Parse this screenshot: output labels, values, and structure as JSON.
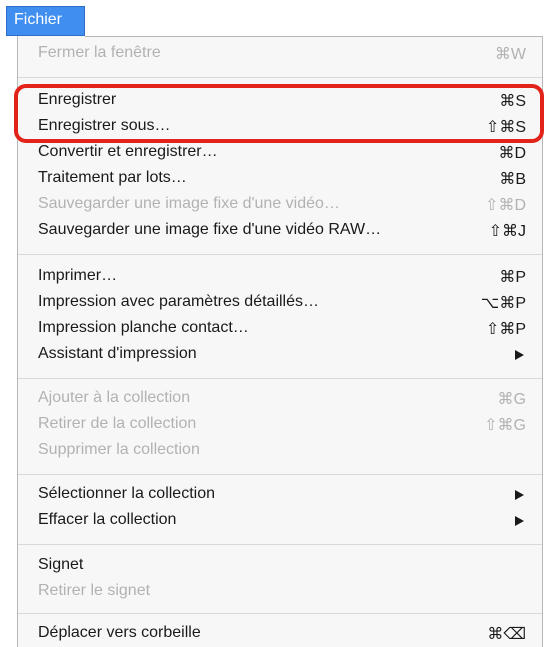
{
  "menubar": {
    "title": "Fichier"
  },
  "menu": {
    "items": [
      {
        "label": "Fermer la fenêtre",
        "shortcut": "⌘W",
        "enabled": false
      },
      {
        "label": "Enregistrer",
        "shortcut": "⌘S",
        "enabled": true
      },
      {
        "label": "Enregistrer sous…",
        "shortcut": "⇧⌘S",
        "enabled": true
      },
      {
        "label": "Convertir et enregistrer…",
        "shortcut": "⌘D",
        "enabled": true
      },
      {
        "label": "Traitement par lots…",
        "shortcut": "⌘B",
        "enabled": true
      },
      {
        "label": "Sauvegarder une image fixe d'une vidéo…",
        "shortcut": "⇧⌘D",
        "enabled": false
      },
      {
        "label": "Sauvegarder une image fixe d'une vidéo RAW…",
        "shortcut": "⇧⌘J",
        "enabled": true
      },
      {
        "label": "Imprimer…",
        "shortcut": "⌘P",
        "enabled": true
      },
      {
        "label": "Impression avec paramètres détaillés…",
        "shortcut": "⌥⌘P",
        "enabled": true
      },
      {
        "label": "Impression planche contact…",
        "shortcut": "⇧⌘P",
        "enabled": true
      },
      {
        "label": "Assistant d'impression",
        "shortcut": "",
        "enabled": true,
        "submenu": true
      },
      {
        "label": "Ajouter à la collection",
        "shortcut": "⌘G",
        "enabled": false
      },
      {
        "label": "Retirer de la collection",
        "shortcut": "⇧⌘G",
        "enabled": false
      },
      {
        "label": "Supprimer la collection",
        "shortcut": "",
        "enabled": false
      },
      {
        "label": "Sélectionner la collection",
        "shortcut": "",
        "enabled": true,
        "submenu": true
      },
      {
        "label": "Effacer la collection",
        "shortcut": "",
        "enabled": true,
        "submenu": true
      },
      {
        "label": "Signet",
        "shortcut": "",
        "enabled": true
      },
      {
        "label": "Retirer le signet",
        "shortcut": "",
        "enabled": false
      },
      {
        "label": "Déplacer vers corbeille",
        "shortcut": "⌘⌫",
        "enabled": true
      }
    ]
  },
  "colors": {
    "menubar_highlight": "#3f8ef0",
    "annotation": "#e2231a",
    "disabled_text": "#b2b2b2"
  }
}
